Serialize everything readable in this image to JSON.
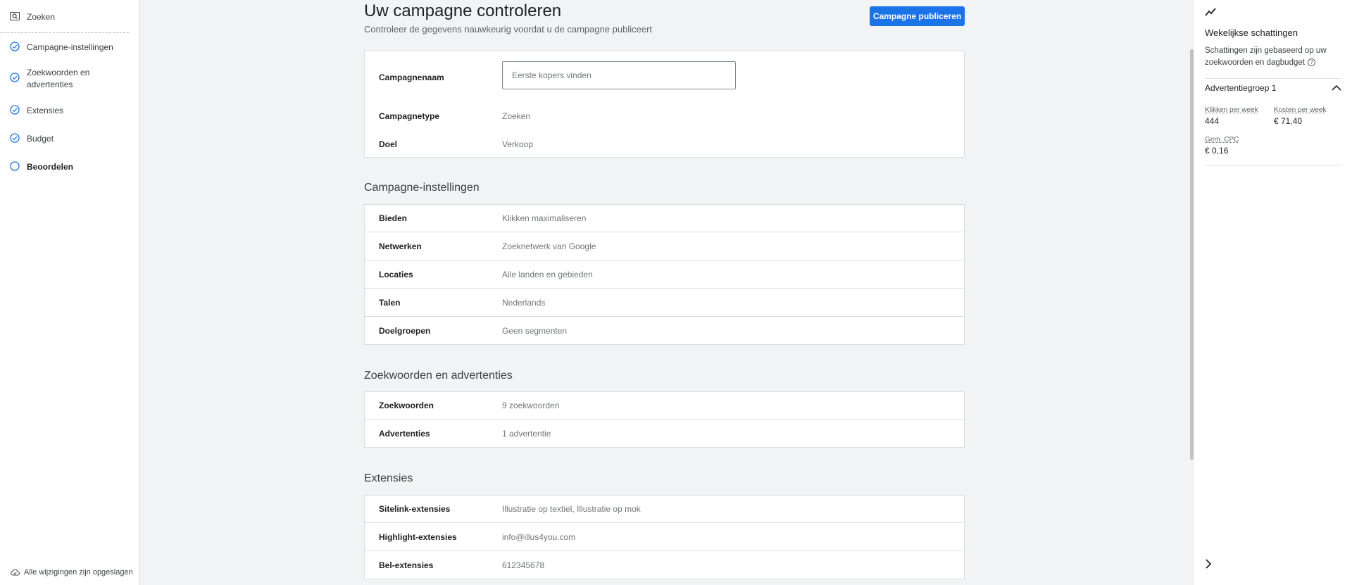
{
  "sidebar": {
    "items": [
      {
        "label": "Zoeken",
        "icon": "search-box-icon"
      },
      {
        "label": "Campagne-instellingen",
        "icon": "check-circle-icon"
      },
      {
        "label": "Zoekwoorden en advertenties",
        "icon": "check-circle-icon"
      },
      {
        "label": "Extensies",
        "icon": "check-circle-icon"
      },
      {
        "label": "Budget",
        "icon": "check-circle-icon"
      },
      {
        "label": "Beoordelen",
        "icon": "empty-circle-icon"
      }
    ],
    "saved_status": "Alle wijzigingen zijn opgeslagen"
  },
  "header": {
    "title": "Uw campagne controleren",
    "subtitle": "Controleer de gegevens nauwkeurig voordat u de campagne publiceert",
    "publish_label": "Campagne publiceren"
  },
  "campaign": {
    "name_label": "Campagnenaam",
    "name_placeholder": "Eerste kopers vinden",
    "type_label": "Campagnetype",
    "type_value": "Zoeken",
    "goal_label": "Doel",
    "goal_value": "Verkoop"
  },
  "sections": [
    {
      "title": "Campagne-instellingen",
      "rows": [
        {
          "key": "Bieden",
          "value": "Klikken maximaliseren"
        },
        {
          "key": "Netwerken",
          "value": "Zoeknetwerk van Google"
        },
        {
          "key": "Locaties",
          "value": "Alle landen en gebieden"
        },
        {
          "key": "Talen",
          "value": "Nederlands"
        },
        {
          "key": "Doelgroepen",
          "value": "Geen segmenten"
        }
      ]
    },
    {
      "title": "Zoekwoorden en advertenties",
      "rows": [
        {
          "key": "Zoekwoorden",
          "value": "9 zoekwoorden"
        },
        {
          "key": "Advertenties",
          "value": "1 advertentie"
        }
      ]
    },
    {
      "title": "Extensies",
      "rows": [
        {
          "key": "Sitelink-extensies",
          "value": "Illustratie op textiel, Illustratie op mok"
        },
        {
          "key": "Highlight-extensies",
          "value": "info@illus4you.com"
        },
        {
          "key": "Bel-extensies",
          "value": "612345678"
        }
      ]
    }
  ],
  "estimates": {
    "title": "Wekelijkse schattingen",
    "description": "Schattingen zijn gebaseerd op uw zoekwoorden en dagbudget",
    "group_label": "Advertentiegroep 1",
    "clicks_label": "Klikken per week",
    "clicks_value": "444",
    "cost_label": "Kosten per week",
    "cost_value": "€ 71,40",
    "cpc_label": "Gem. CPC",
    "cpc_value": "€ 0,16"
  },
  "colors": {
    "accent": "#1a73e8",
    "background": "#f1f3f4"
  }
}
